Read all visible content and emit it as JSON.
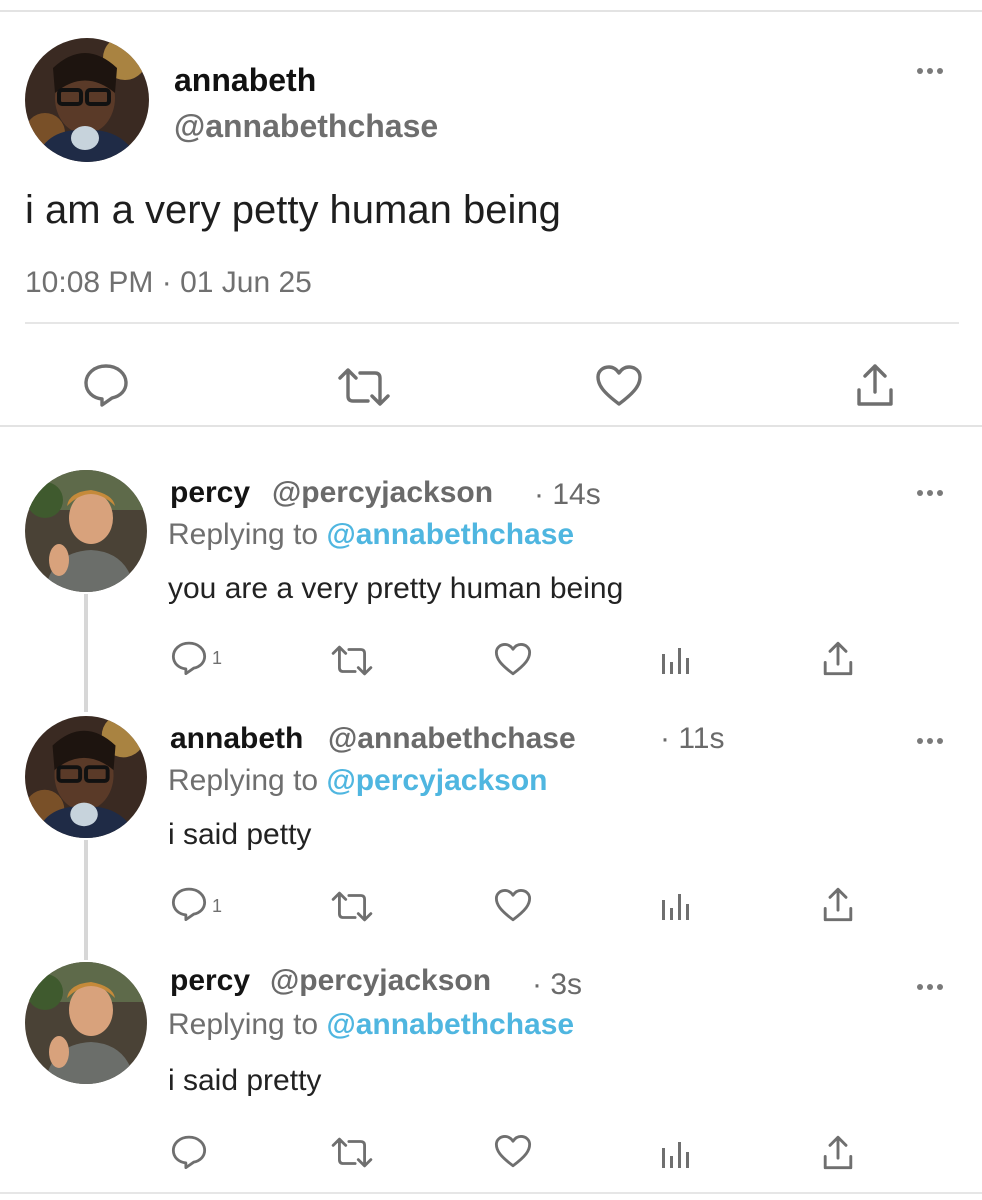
{
  "main_tweet": {
    "name": "annabeth",
    "handle": "@annabethchase",
    "text": "i am a very petty human being",
    "timestamp": "10:08 PM · 01 Jun 25",
    "avatar": "annabeth-avatar",
    "actions": [
      "reply-icon",
      "retweet-icon",
      "like-icon",
      "share-icon"
    ],
    "more_icon": "more-horizontal-icon"
  },
  "replies": [
    {
      "name": "percy",
      "handle": "@percyjackson",
      "time": "· 14s",
      "replying_prefix": "Replying to",
      "replying_to": "@annabethchase",
      "text": "you are a very pretty human being",
      "reply_count": "1",
      "avatar": "percy-avatar"
    },
    {
      "name": "annabeth",
      "handle": "@annabethchase",
      "time": "· 11s",
      "replying_prefix": "Replying to",
      "replying_to": "@percyjackson",
      "text": "i said petty",
      "reply_count": "1",
      "avatar": "annabeth-avatar"
    },
    {
      "name": "percy",
      "handle": "@percyjackson",
      "time": "· 3s",
      "replying_prefix": "Replying to",
      "replying_to": "@annabethchase",
      "text": "i said pretty",
      "reply_count": "",
      "avatar": "percy-avatar"
    }
  ],
  "colors": {
    "mention": "#4fb6e0",
    "muted": "#707070",
    "icon": "#6f6f6f",
    "divider": "#e3e3e3"
  }
}
